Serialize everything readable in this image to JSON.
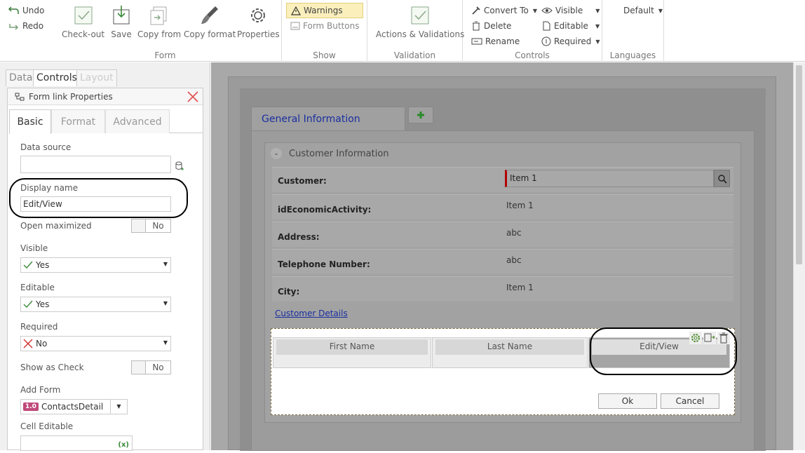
{
  "ribbon": {
    "undo": "Undo",
    "redo": "Redo",
    "form": {
      "label": "Form",
      "checkout": "Check-out",
      "save": "Save",
      "copy_from": "Copy from",
      "copy_format": "Copy format",
      "properties": "Properties"
    },
    "show": {
      "label": "Show",
      "warnings": "Warnings",
      "form_buttons": "Form Buttons"
    },
    "validation": {
      "label": "Validation",
      "actions": "Actions & Validations"
    },
    "controls": {
      "label": "Controls",
      "convert_to": "Convert To",
      "delete": "Delete",
      "rename": "Rename",
      "visible": "Visible",
      "editable": "Editable",
      "required": "Required"
    },
    "languages": {
      "label": "Languages",
      "default": "Default"
    }
  },
  "left_tabs": {
    "data": "Data",
    "controls": "Controls",
    "layout": "Layout"
  },
  "props": {
    "title": "Form link Properties",
    "tabs": {
      "basic": "Basic",
      "format": "Format",
      "advanced": "Advanced"
    },
    "data_source_label": "Data source",
    "data_source_value": "",
    "display_name_label": "Display name",
    "display_name_value": "Edit/View",
    "open_max_label": "Open maximized",
    "open_max_value": "No",
    "visible_label": "Visible",
    "visible_value": "Yes",
    "editable_label": "Editable",
    "editable_value": "Yes",
    "required_label": "Required",
    "required_value": "No",
    "show_check_label": "Show as Check",
    "show_check_value": "No",
    "add_form_label": "Add Form",
    "add_form_version": "1.0",
    "add_form_value": "ContactsDetail",
    "cell_editable_label": "Cell Editable"
  },
  "form": {
    "tab_title": "General Information",
    "section_title": "Customer Information",
    "rows": [
      {
        "label": "Customer:",
        "value": "Item 1"
      },
      {
        "label": "idEconomicActivity:",
        "value": "Item 1"
      },
      {
        "label": "Address:",
        "value": "abc"
      },
      {
        "label": "Telephone Number:",
        "value": "abc"
      },
      {
        "label": "City:",
        "value": "Item 1"
      }
    ],
    "link": "Customer Details",
    "grid": {
      "columns": [
        "First Name",
        "Last Name",
        "Edit/View"
      ],
      "ok": "Ok",
      "cancel": "Cancel"
    }
  }
}
